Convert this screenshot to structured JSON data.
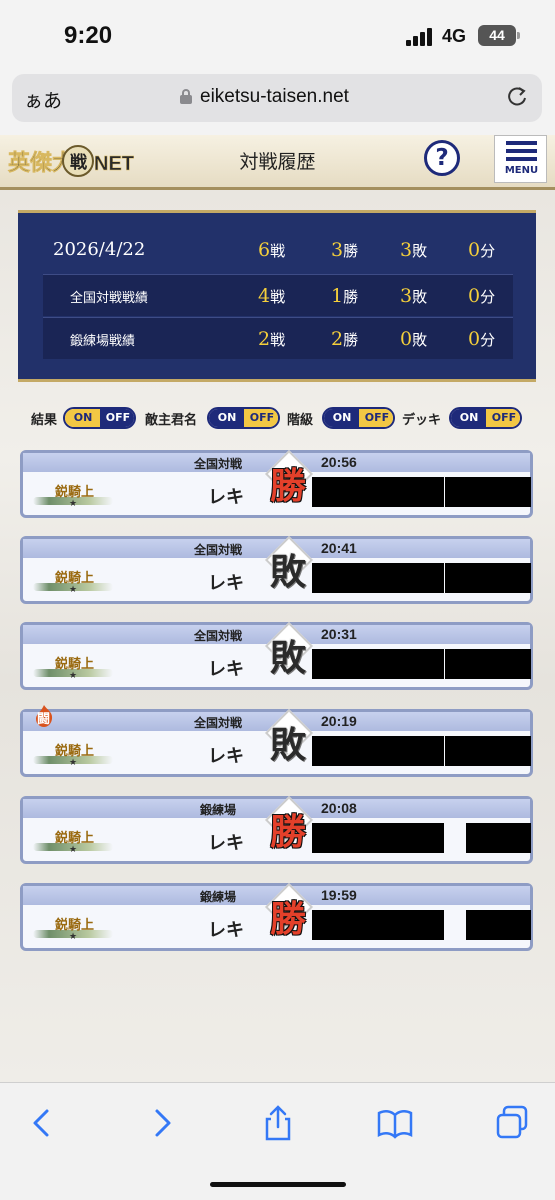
{
  "status_bar": {
    "time": "9:20",
    "network": "4G",
    "battery": "44"
  },
  "browser": {
    "aa_label": "ぁあ",
    "url": "eiketsu-taisen.net"
  },
  "header": {
    "logo": "英傑大戦NET",
    "title": "対戦履歴",
    "help": "?",
    "menu": "MENU"
  },
  "stats": {
    "date": "2026/4/22",
    "units": {
      "battles": "戦",
      "wins": "勝",
      "losses": "敗",
      "draws": "分"
    },
    "total": {
      "battles": "6",
      "wins": "3",
      "losses": "3",
      "draws": "0"
    },
    "rows": [
      {
        "label": "全国対戦戦績",
        "battles": "4",
        "wins": "1",
        "losses": "3",
        "draws": "0"
      },
      {
        "label": "鍛練場戦績",
        "battles": "2",
        "wins": "2",
        "losses": "0",
        "draws": "0"
      }
    ]
  },
  "toggles": [
    {
      "label": "結果",
      "on": "ON",
      "off": "OFF",
      "state": "on"
    },
    {
      "label": "敵主君名",
      "on": "ON",
      "off": "OFF",
      "state": "off"
    },
    {
      "label": "階級",
      "on": "ON",
      "off": "OFF",
      "state": "off"
    },
    {
      "label": "デッキ",
      "on": "ON",
      "off": "OFF",
      "state": "off"
    }
  ],
  "matches": [
    {
      "mode": "全国対戦",
      "time": "20:56",
      "name": "レキ",
      "result": "勝",
      "rank": "鋭騎上"
    },
    {
      "mode": "全国対戦",
      "time": "20:41",
      "name": "レキ",
      "result": "敗",
      "rank": "鋭騎上"
    },
    {
      "mode": "全国対戦",
      "time": "20:31",
      "name": "レキ",
      "result": "敗",
      "rank": "鋭騎上"
    },
    {
      "mode": "全国対戦",
      "time": "20:19",
      "name": "レキ",
      "result": "敗",
      "rank": "鋭騎上",
      "badge": "闘"
    },
    {
      "mode": "鍛練場",
      "time": "20:08",
      "name": "レキ",
      "result": "勝",
      "rank": "鋭騎上"
    },
    {
      "mode": "鍛練場",
      "time": "19:59",
      "name": "レキ",
      "result": "勝",
      "rank": "鋭騎上"
    }
  ]
}
